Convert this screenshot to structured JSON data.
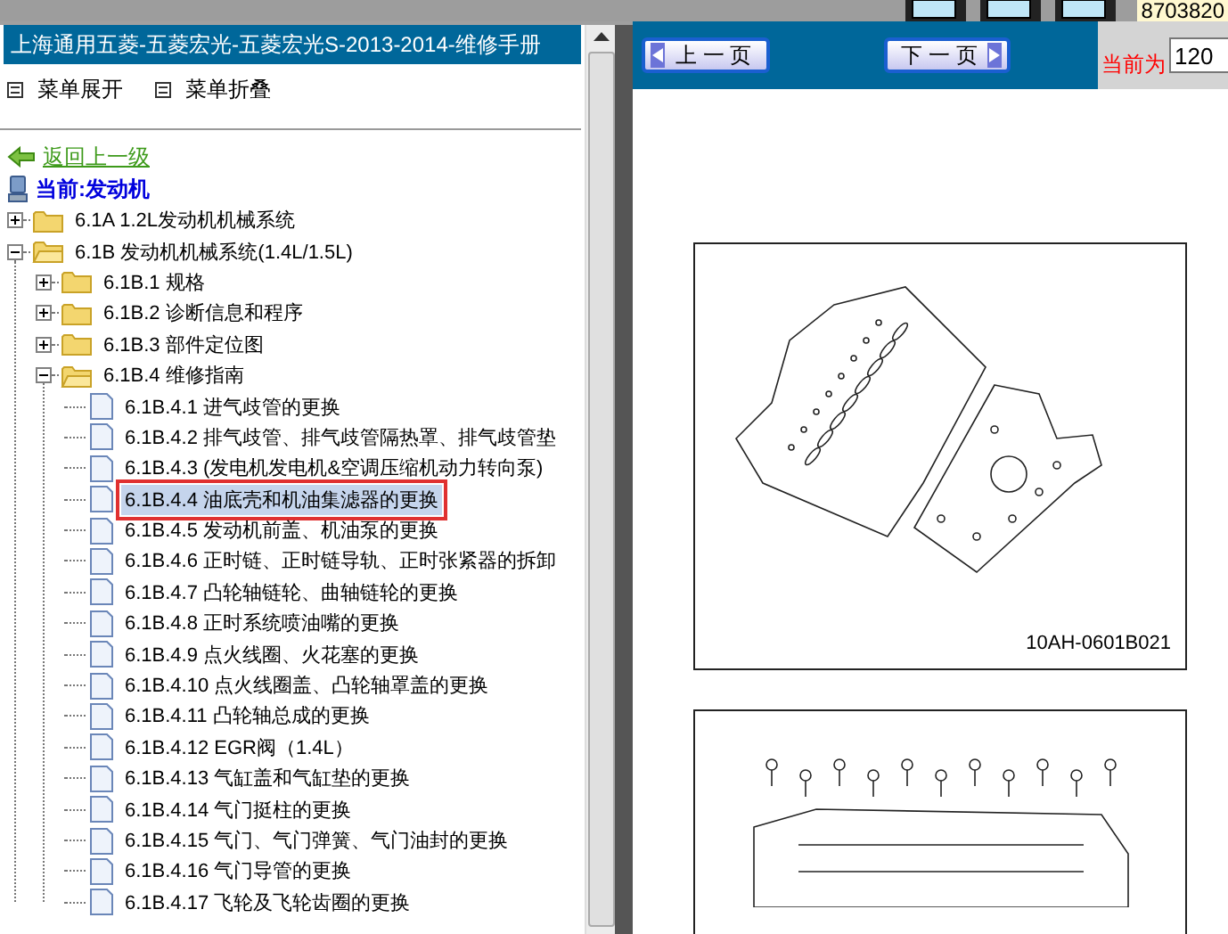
{
  "top_strip": {
    "code": "8703820"
  },
  "left_panel": {
    "title": "上海通用五菱-五菱宏光-五菱宏光S-2013-2014-维修手册",
    "menu_actions": [
      {
        "label": "菜单展开"
      },
      {
        "label": "菜单折叠"
      }
    ],
    "back_link": "返回上一级",
    "current": "当前:发动机",
    "tree": [
      {
        "kind": "folder",
        "label": "6.1A 1.2L发动机机械系统",
        "expanded": false
      },
      {
        "kind": "folder",
        "label": "6.1B 发动机机械系统(1.4L/1.5L)",
        "expanded": true,
        "children": [
          {
            "kind": "folder",
            "label": "6.1B.1 规格",
            "expanded": false
          },
          {
            "kind": "folder",
            "label": "6.1B.2 诊断信息和程序",
            "expanded": false
          },
          {
            "kind": "folder",
            "label": "6.1B.3 部件定位图",
            "expanded": false
          },
          {
            "kind": "folder",
            "label": "6.1B.4 维修指南",
            "expanded": true,
            "children": [
              {
                "kind": "page",
                "label": "6.1B.4.1 进气歧管的更换",
                "selected": false
              },
              {
                "kind": "page",
                "label": "6.1B.4.2 排气歧管、排气歧管隔热罩、排气歧管垫",
                "selected": false
              },
              {
                "kind": "page",
                "label": "6.1B.4.3 (发电机发电机&空调压缩机动力转向泵)",
                "selected": false
              },
              {
                "kind": "page",
                "label": "6.1B.4.4 油底壳和机油集滤器的更换",
                "selected": true
              },
              {
                "kind": "page",
                "label": "6.1B.4.5 发动机前盖、机油泵的更换",
                "selected": false
              },
              {
                "kind": "page",
                "label": "6.1B.4.6 正时链、正时链导轨、正时张紧器的拆卸",
                "selected": false
              },
              {
                "kind": "page",
                "label": "6.1B.4.7 凸轮轴链轮、曲轴链轮的更换",
                "selected": false
              },
              {
                "kind": "page",
                "label": "6.1B.4.8 正时系统喷油嘴的更换",
                "selected": false
              },
              {
                "kind": "page",
                "label": "6.1B.4.9 点火线圈、火花塞的更换",
                "selected": false
              },
              {
                "kind": "page",
                "label": "6.1B.4.10 点火线圈盖、凸轮轴罩盖的更换",
                "selected": false
              },
              {
                "kind": "page",
                "label": "6.1B.4.11 凸轮轴总成的更换",
                "selected": false
              },
              {
                "kind": "page",
                "label": "6.1B.4.12 EGR阀（1.4L）",
                "selected": false
              },
              {
                "kind": "page",
                "label": "6.1B.4.13 气缸盖和气缸垫的更换",
                "selected": false
              },
              {
                "kind": "page",
                "label": "6.1B.4.14 气门挺柱的更换",
                "selected": false
              },
              {
                "kind": "page",
                "label": "6.1B.4.15 气门、气门弹簧、气门油封的更换",
                "selected": false
              },
              {
                "kind": "page",
                "label": "6.1B.4.16 气门导管的更换",
                "selected": false
              },
              {
                "kind": "page",
                "label": "6.1B.4.17 飞轮及飞轮齿圈的更换",
                "selected": false
              }
            ]
          }
        ]
      }
    ]
  },
  "toolbar": {
    "prev_button": "上 一 页",
    "next_button": "下 一 页",
    "page_label": "当前为",
    "page_value": "120"
  },
  "document": {
    "figures": [
      {
        "kind": "gasket",
        "caption": "10AH-0601B021"
      },
      {
        "kind": "engine"
      }
    ]
  }
}
